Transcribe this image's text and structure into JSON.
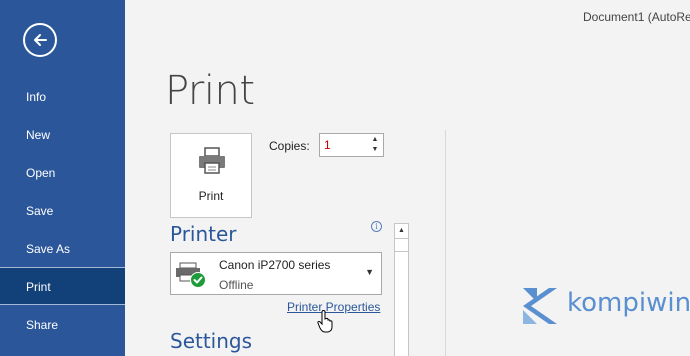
{
  "window": {
    "document_title": "Document1 (AutoRe"
  },
  "sidebar": {
    "items": [
      {
        "label": "Info"
      },
      {
        "label": "New"
      },
      {
        "label": "Open"
      },
      {
        "label": "Save"
      },
      {
        "label": "Save As"
      },
      {
        "label": "Print",
        "active": true
      },
      {
        "label": "Share"
      }
    ]
  },
  "main": {
    "title": "Print",
    "print_button_label": "Print",
    "copies": {
      "label": "Copies:",
      "value": "1"
    },
    "printer": {
      "heading": "Printer",
      "name": "Canon iP2700 series",
      "status": "Offline",
      "properties_link": "Printer Properties"
    },
    "settings_heading": "Settings"
  },
  "watermark": {
    "text": "kompiwin"
  },
  "colors": {
    "sidebar": "#2b579a",
    "sidebar_active": "#124078",
    "accent": "#2b579a"
  }
}
